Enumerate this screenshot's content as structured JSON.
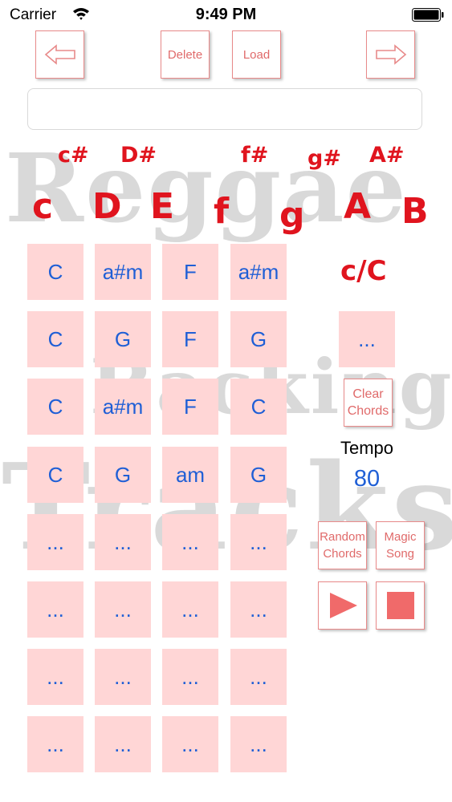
{
  "status_bar": {
    "carrier": "Carrier",
    "time": "9:49 PM"
  },
  "toolbar": {
    "back_icon": "arrow-left-icon",
    "delete_label": "Delete",
    "load_label": "Load",
    "forward_icon": "arrow-right-icon"
  },
  "song_name": {
    "value": ""
  },
  "watermark": {
    "line1": "Reggae",
    "line2": "Backing",
    "line3": "Tracks"
  },
  "notes": {
    "sharps": [
      "c#",
      "D#",
      "f#",
      "g#",
      "A#"
    ],
    "naturals": [
      "c",
      "D",
      "E",
      "f",
      "g",
      "A",
      "B"
    ]
  },
  "chord_grid": {
    "rows": [
      [
        "C",
        "a#m",
        "F",
        "a#m"
      ],
      [
        "C",
        "G",
        "F",
        "G"
      ],
      [
        "C",
        "a#m",
        "F",
        "C"
      ],
      [
        "C",
        "G",
        "am",
        "G"
      ],
      [
        "...",
        "...",
        "...",
        "..."
      ],
      [
        "...",
        "...",
        "...",
        "..."
      ],
      [
        "...",
        "...",
        "...",
        "..."
      ],
      [
        "...",
        "...",
        "...",
        "..."
      ]
    ]
  },
  "side_panel": {
    "key_label": "c/C",
    "selected_chord": "...",
    "clear_label_1": "Clear",
    "clear_label_2": "Chords",
    "tempo_label": "Tempo",
    "tempo_value": "80",
    "random_label_1": "Random",
    "random_label_2": "Chords",
    "magic_label_1": "Magic",
    "magic_label_2": "Song",
    "play_icon": "play-icon",
    "stop_icon": "stop-icon"
  },
  "colors": {
    "accent_red": "#e0141e",
    "cell_pink": "#ffd6d6",
    "chord_blue": "#1f5fd6"
  }
}
